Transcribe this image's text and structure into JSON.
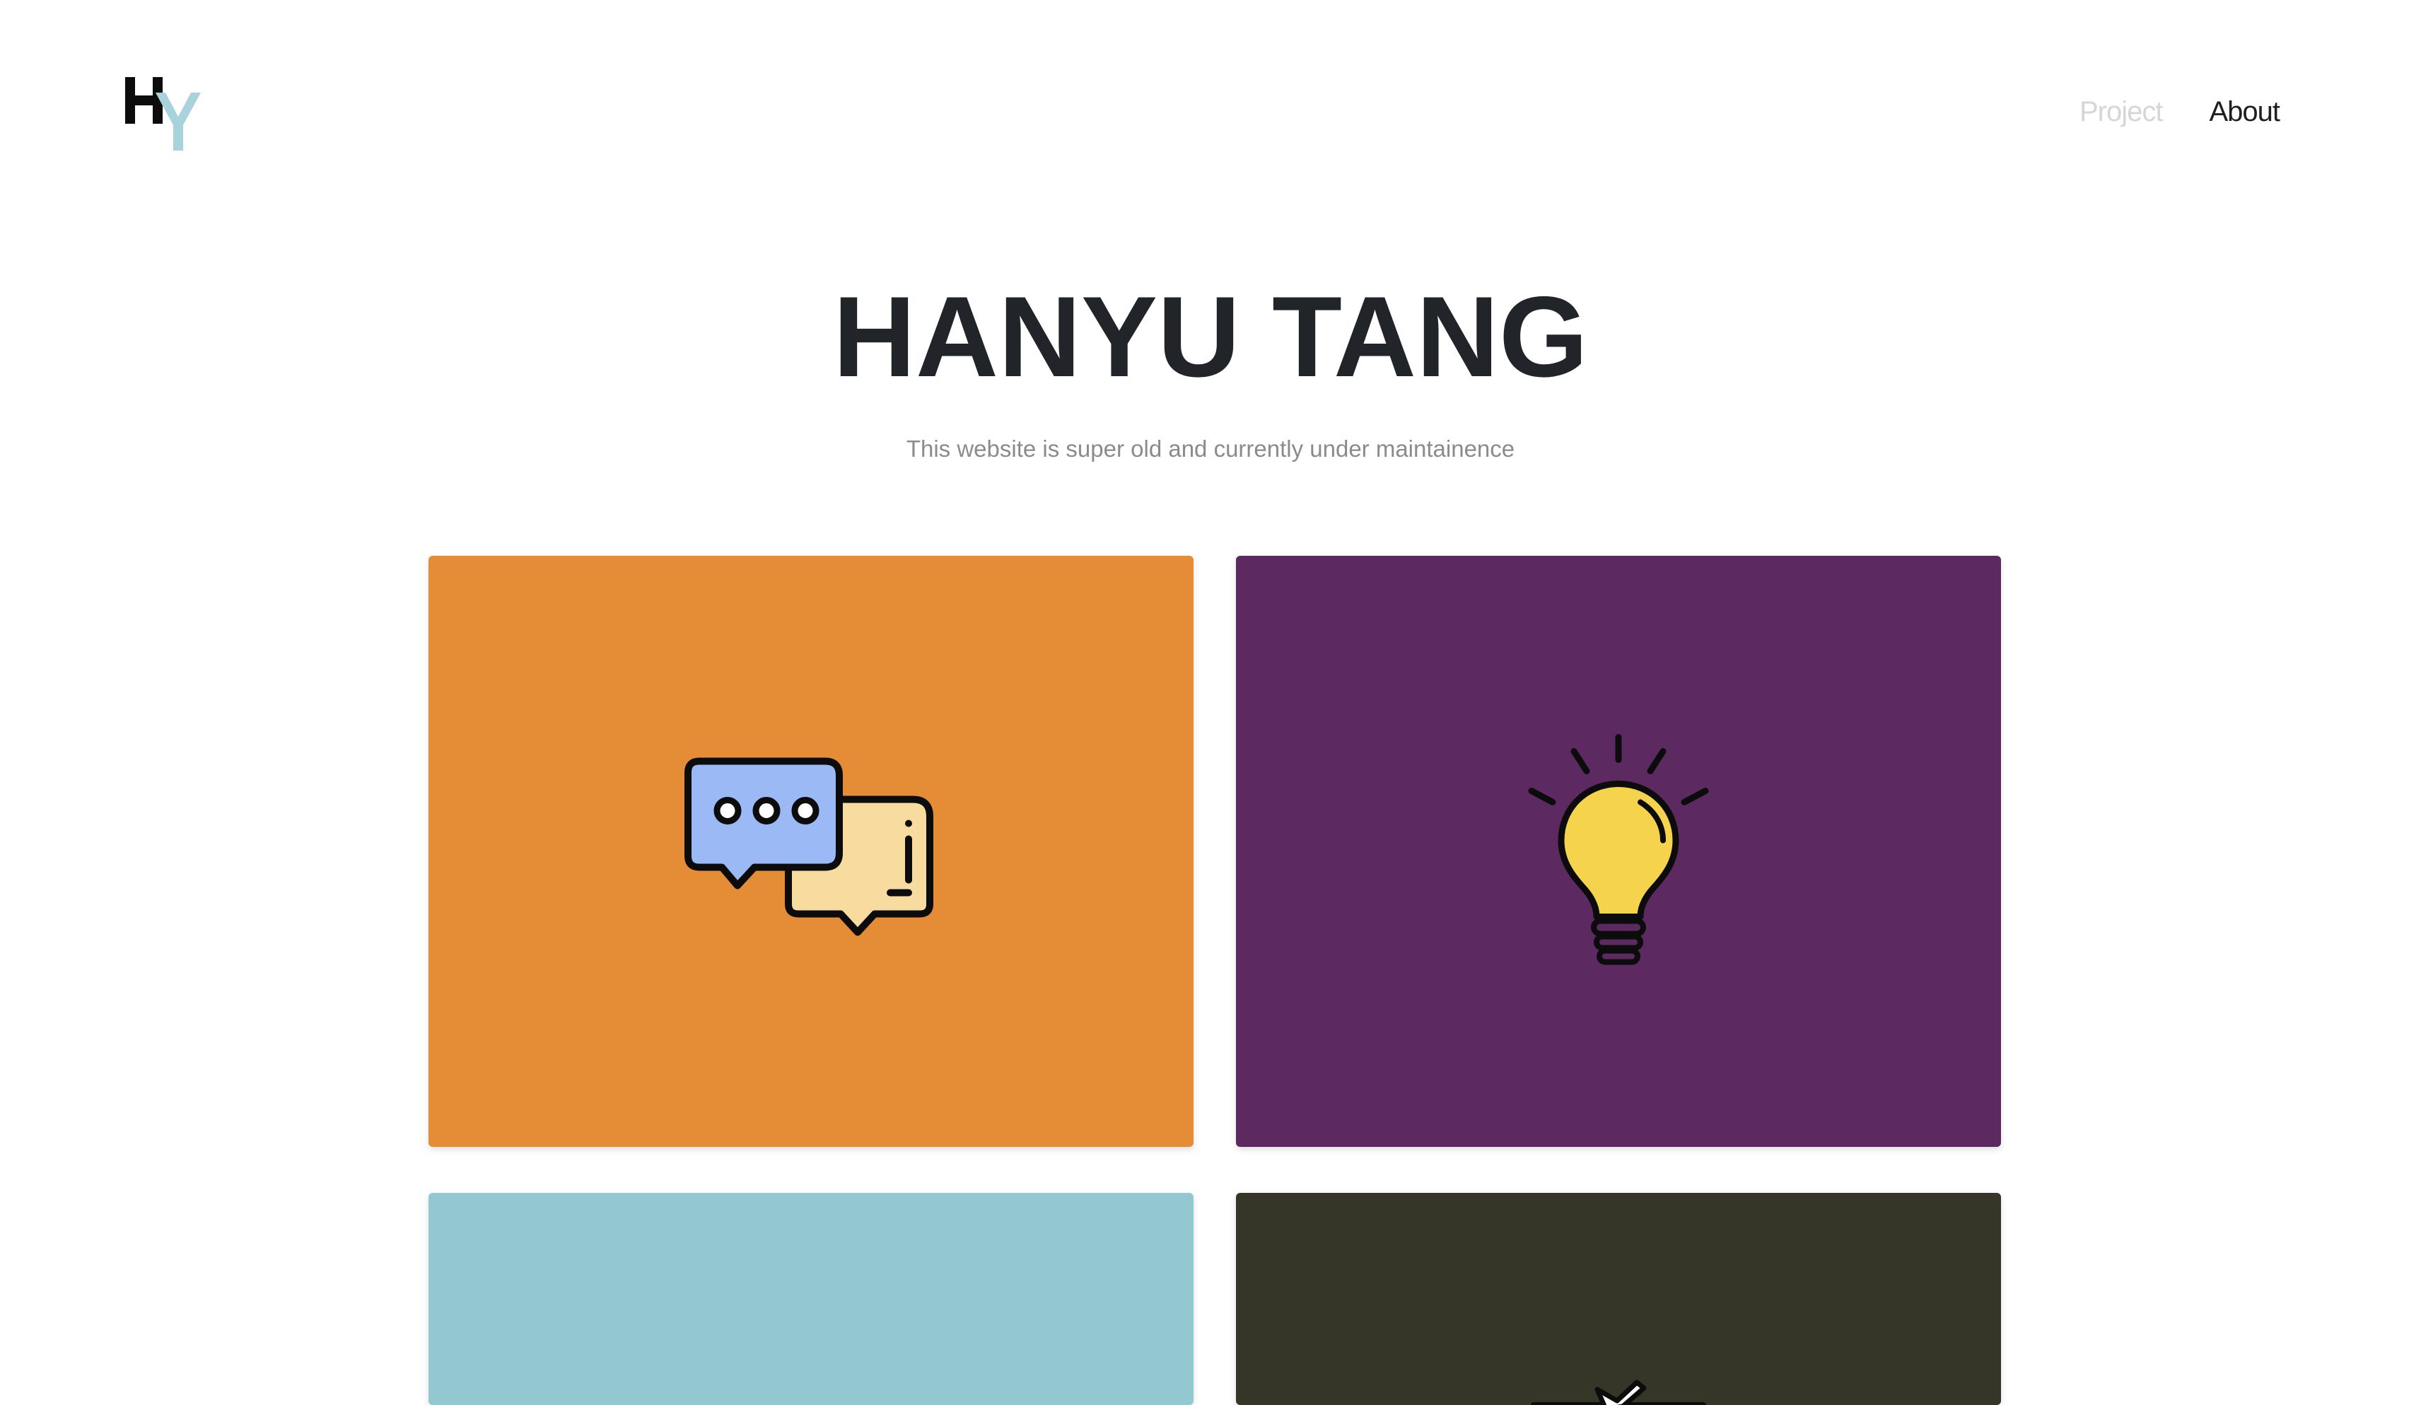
{
  "brand": {
    "logo_letters": "HY",
    "accent_color": "#a9d3dc"
  },
  "nav": {
    "items": [
      {
        "label": "Project",
        "state": "inactive"
      },
      {
        "label": "About",
        "state": "active"
      }
    ]
  },
  "hero": {
    "title": "HANYU TANG",
    "subtitle": "This website is super old and currently under maintainence"
  },
  "projects": [
    {
      "color": "#e58c37",
      "icon": "chat-bubbles-icon"
    },
    {
      "color": "#5c2a61",
      "icon": "lightbulb-icon"
    },
    {
      "color": "#93c8d1",
      "icon": ""
    },
    {
      "color": "#363628",
      "icon": "airplane-icon"
    }
  ]
}
